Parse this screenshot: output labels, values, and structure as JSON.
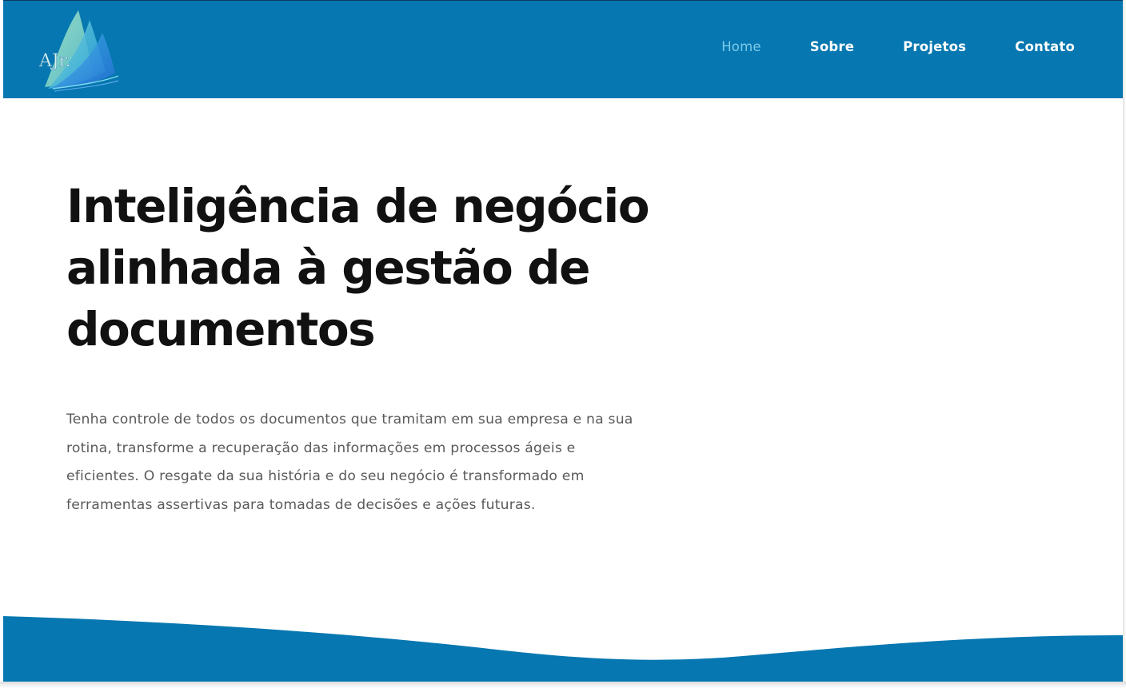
{
  "brand": {
    "logo_text": "AJr.",
    "colors": {
      "primary": "#0677b0",
      "nav_active": "#7ecbea",
      "title": "#111111",
      "body_text": "#5a5a5a"
    }
  },
  "nav": {
    "items": [
      {
        "label": "Home",
        "active": true
      },
      {
        "label": "Sobre",
        "active": false
      },
      {
        "label": "Projetos",
        "active": false
      },
      {
        "label": "Contato",
        "active": false
      }
    ]
  },
  "hero": {
    "title_lines": [
      "Inteligência de negócio",
      "alinhada à gestão de",
      "documentos"
    ],
    "text_lines": [
      "Tenha controle de todos os documentos que tramitam em sua empresa e na sua",
      "rotina, transforme a recuperação das informações em processos ágeis e",
      "eficientes. O resgate da sua história e do seu negócio é transformado em",
      "ferramentas assertivas para tomadas de decisões e ações futuras."
    ]
  }
}
